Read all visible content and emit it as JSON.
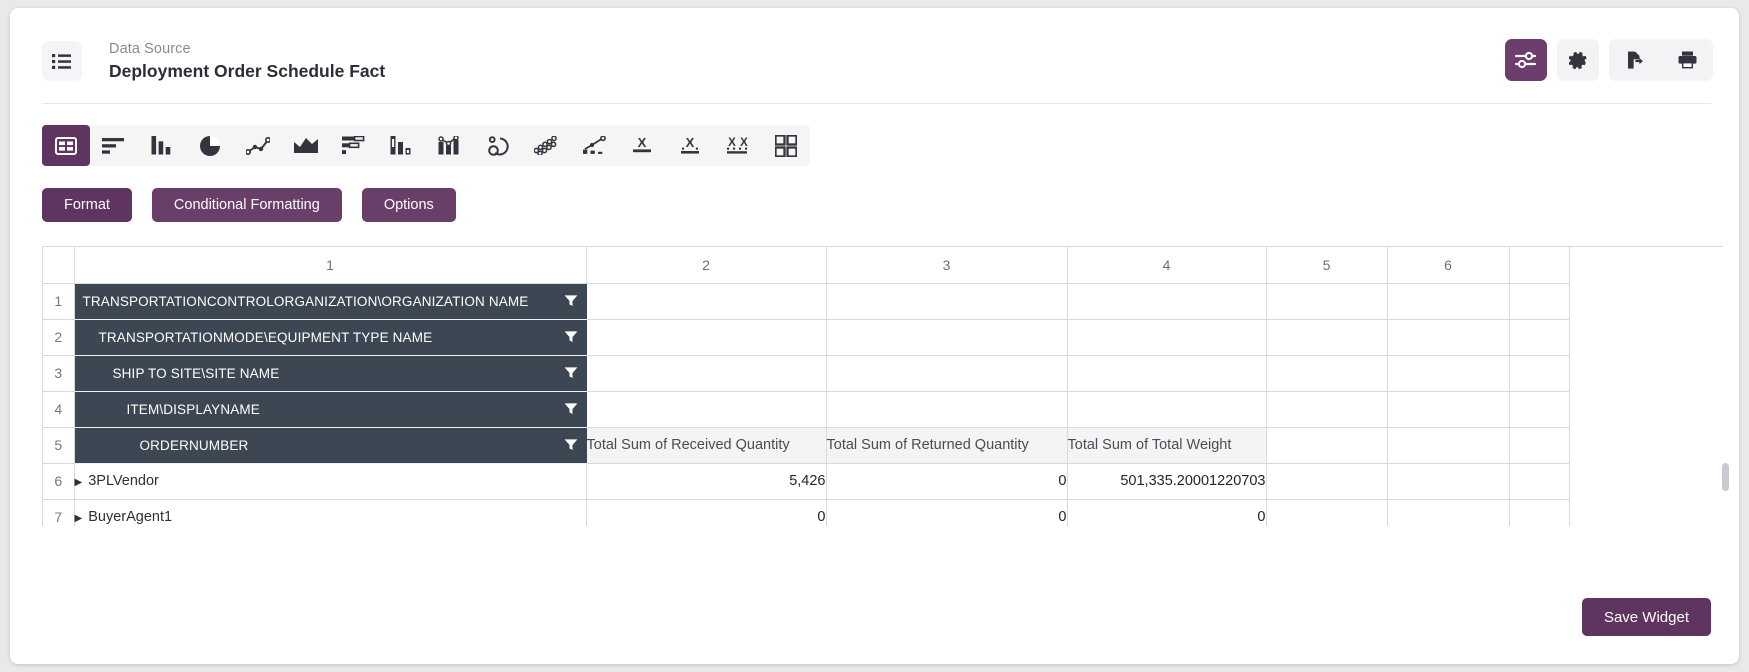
{
  "header": {
    "datasource_label": "Data Source",
    "datasource_name": "Deployment Order Schedule Fact",
    "list_icon": "list-icon",
    "actions": [
      {
        "name": "filter-settings-button",
        "icon": "sliders-icon",
        "active": true
      },
      {
        "name": "settings-button",
        "icon": "gear-icon",
        "active": false
      },
      {
        "name": "export-button",
        "icon": "file-export-icon",
        "active": false
      },
      {
        "name": "print-button",
        "icon": "printer-icon",
        "active": false
      }
    ]
  },
  "viz_toolbar": {
    "selected_index": 0,
    "items": [
      {
        "name": "viz-table",
        "icon": "table-icon"
      },
      {
        "name": "viz-horizontal-bar",
        "icon": "horizontal-bar-icon"
      },
      {
        "name": "viz-column",
        "icon": "column-chart-icon"
      },
      {
        "name": "viz-pie",
        "icon": "pie-chart-icon"
      },
      {
        "name": "viz-line",
        "icon": "line-chart-icon"
      },
      {
        "name": "viz-area",
        "icon": "area-chart-icon"
      },
      {
        "name": "viz-stacked-bar",
        "icon": "stacked-bar-icon"
      },
      {
        "name": "viz-bullet",
        "icon": "bullet-chart-icon"
      },
      {
        "name": "viz-combo",
        "icon": "combo-chart-icon"
      },
      {
        "name": "viz-donut-gauge",
        "icon": "gauge-icon"
      },
      {
        "name": "viz-bubble",
        "icon": "bubble-chart-icon"
      },
      {
        "name": "viz-scatter-line",
        "icon": "scatter-line-icon"
      },
      {
        "name": "viz-x-single",
        "icon": "x-axis-single-icon"
      },
      {
        "name": "viz-x-dotted",
        "icon": "x-axis-dotted-icon"
      },
      {
        "name": "viz-xx-dotted",
        "icon": "xx-axis-dotted-icon"
      },
      {
        "name": "viz-matrix",
        "icon": "matrix-icon"
      }
    ]
  },
  "format_buttons": [
    {
      "name": "format-button",
      "label": "Format"
    },
    {
      "name": "conditional-formatting-button",
      "label": "Conditional Formatting"
    },
    {
      "name": "options-button",
      "label": "Options"
    }
  ],
  "grid": {
    "column_headers": [
      "1",
      "2",
      "3",
      "4",
      "5",
      "6",
      ""
    ],
    "row_numbers": [
      "1",
      "2",
      "3",
      "4",
      "5",
      "6",
      "7"
    ],
    "dimension_rows": [
      {
        "row": "1",
        "label": "TRANSPORTATIONCONTROLORGANIZATION\\ORGANIZATION NAME",
        "indent": 0
      },
      {
        "row": "2",
        "label": "TRANSPORTATIONMODE\\EQUIPMENT TYPE NAME",
        "indent": 1
      },
      {
        "row": "3",
        "label": "SHIP TO SITE\\SITE NAME",
        "indent": 2
      },
      {
        "row": "4",
        "label": "ITEM\\DISPLAYNAME",
        "indent": 3
      },
      {
        "row": "5",
        "label": "ORDERNUMBER",
        "indent": 4
      }
    ],
    "measure_headers": [
      "Total Sum of Received Quantity",
      "Total Sum of Returned Quantity",
      "Total Sum of Total Weight"
    ],
    "data_rows": [
      {
        "row": "6",
        "label": "3PLVendor",
        "expandable": true,
        "values": [
          "5,426",
          "0",
          "501,335.20001220703"
        ]
      },
      {
        "row": "7",
        "label": "BuyerAgent1",
        "expandable": true,
        "values": [
          "0",
          "0",
          "0"
        ]
      }
    ]
  },
  "footer": {
    "save_widget_label": "Save Widget"
  },
  "colors": {
    "accent": "#5f3460",
    "header_dark": "#3d4754",
    "measure_bg": "#f4f4f5",
    "toolbar_bg": "#f5f5f6"
  }
}
